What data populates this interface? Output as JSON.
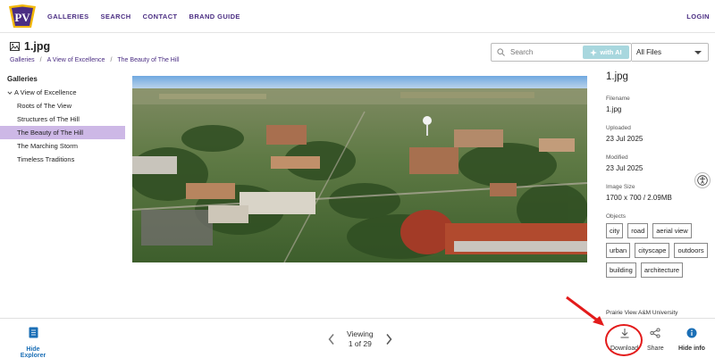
{
  "nav": {
    "links": [
      "GALLERIES",
      "SEARCH",
      "CONTACT",
      "BRAND GUIDE"
    ],
    "login": "LOGIN",
    "logo_text": "PV"
  },
  "header": {
    "file_title": "1.jpg",
    "breadcrumb": [
      "Galleries",
      "A View of Excellence",
      "The Beauty of The Hill"
    ],
    "breadcrumb_sep": "/"
  },
  "search": {
    "placeholder": "Search",
    "ai_label": "with AI",
    "filter_value": "All Files"
  },
  "sidebar": {
    "title": "Galleries",
    "root": "A View of Excellence",
    "items": [
      "Roots of The View",
      "Structures of The Hill",
      "The Beauty of The Hill",
      "The Marching Storm",
      "Timeless Traditions"
    ],
    "active_index": 2
  },
  "info": {
    "title": "1.jpg",
    "filename_label": "Filename",
    "filename": "1.jpg",
    "uploaded_label": "Uploaded",
    "uploaded": "23 Jul 2025",
    "modified_label": "Modified",
    "modified": "23 Jul 2025",
    "size_label": "Image Size",
    "size": "1700 x 700 / 2.09MB",
    "objects_label": "Objects",
    "objects": [
      "city",
      "road",
      "aerial view",
      "urban",
      "cityscape",
      "outdoors",
      "building",
      "architecture"
    ],
    "source": "Prairie View A&M University"
  },
  "footer": {
    "hide_explorer": "Hide Explorer",
    "viewing": "Viewing",
    "position": "1 of 29",
    "download": "Download",
    "share": "Share",
    "hide_info": "Hide info"
  },
  "colors": {
    "brand_purple": "#4b2e83",
    "active_bg": "#cdb8e6",
    "footer_blue": "#1b6fb6",
    "ai_button": "#a8d7de",
    "annotation_red": "#e31b1b"
  }
}
